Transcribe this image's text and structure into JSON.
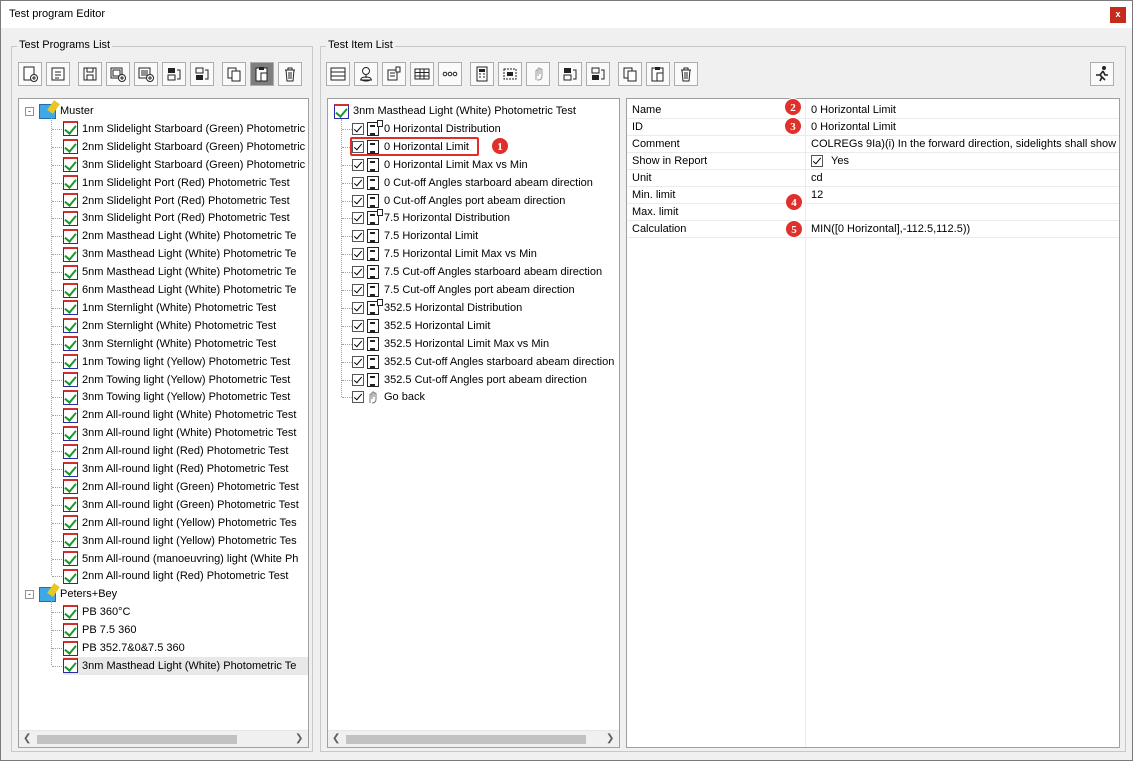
{
  "window": {
    "title": "Test program Editor",
    "close_label": "x"
  },
  "left_group": {
    "label": "Test Programs List",
    "toolbar": [
      "new-program-icon",
      "open-icon",
      "save-icon",
      "add-item-icon",
      "add-copy-icon",
      "move-up-icon",
      "move-down-icon",
      "copy-icon",
      "paste-icon",
      "delete-icon"
    ],
    "folders": [
      {
        "name": "Muster",
        "expander": "-",
        "items": [
          "1nm Slidelight Starboard (Green) Photometric",
          "2nm Slidelight Starboard (Green) Photometric",
          "3nm Slidelight Starboard (Green) Photometric",
          "1nm Slidelight Port (Red) Photometric Test",
          "2nm Slidelight Port (Red) Photometric Test",
          "3nm Slidelight Port (Red) Photometric Test",
          "2nm Masthead Light (White) Photometric Te",
          "3nm Masthead Light (White) Photometric Te",
          "5nm Masthead Light (White) Photometric Te",
          "6nm Masthead Light (White) Photometric Te",
          "1nm Sternlight  (White) Photometric Test",
          "2nm Sternlight  (White) Photometric Test",
          "3nm Sternlight  (White) Photometric Test",
          "1nm Towing light (Yellow) Photometric Test",
          "2nm Towing light (Yellow) Photometric Test",
          "3nm Towing light (Yellow) Photometric Test",
          "2nm All-round light (White) Photometric Test",
          "3nm All-round light (White) Photometric Test",
          "2nm All-round light (Red) Photometric Test",
          "3nm All-round light (Red) Photometric Test",
          "2nm All-round light (Green) Photometric Test",
          "3nm All-round light (Green) Photometric Test",
          "2nm All-round light (Yellow) Photometric Tes",
          "3nm All-round light (Yellow) Photometric Tes",
          "5nm All-round (manoeuvring) light (White Ph",
          "2nm All-round light (Red) Photometric Test"
        ]
      },
      {
        "name": "Peters+Bey",
        "expander": "-",
        "items": [
          "PB 360°C",
          "PB 7.5 360",
          "PB 352.7&0&7.5  360",
          "3nm Masthead Light (White) Photometric Te"
        ]
      }
    ]
  },
  "middle_group": {
    "label": "Test Item List",
    "toolbar": [
      "header-icon",
      "location-icon",
      "distribution-icon",
      "table-icon",
      "dots-icon",
      "calculator-icon",
      "select-icon",
      "hand-icon",
      "move-up-icon",
      "move-down-icon",
      "copy-icon",
      "paste-icon",
      "delete-icon"
    ],
    "run_icon": "run-icon",
    "root": "3nm Masthead Light (White) Photometric Test",
    "items": [
      {
        "label": "0 Horizontal Distribution",
        "icon": "distribution"
      },
      {
        "label": "0 Horizontal Limit",
        "icon": "calc"
      },
      {
        "label": "0 Horizontal Limit Max vs Min",
        "icon": "calc"
      },
      {
        "label": "0 Cut-off Angles starboard abeam direction",
        "icon": "calc"
      },
      {
        "label": "0 Cut-off Angles port abeam direction",
        "icon": "calc"
      },
      {
        "label": "7.5 Horizontal Distribution",
        "icon": "distribution"
      },
      {
        "label": "7.5 Horizontal Limit",
        "icon": "calc"
      },
      {
        "label": "7.5 Horizontal Limit Max vs Min",
        "icon": "calc"
      },
      {
        "label": "7.5 Cut-off Angles starboard abeam direction",
        "icon": "calc"
      },
      {
        "label": "7.5 Cut-off Angles port abeam direction",
        "icon": "calc"
      },
      {
        "label": "352.5 Horizontal Distribution",
        "icon": "distribution"
      },
      {
        "label": "352.5 Horizontal Limit",
        "icon": "calc"
      },
      {
        "label": "352.5 Horizontal Limit Max vs Min",
        "icon": "calc"
      },
      {
        "label": "352.5 Cut-off Angles starboard abeam direction",
        "icon": "calc"
      },
      {
        "label": "352.5 Cut-off Angles port abeam direction",
        "icon": "calc"
      },
      {
        "label": "Go back",
        "icon": "hand"
      }
    ]
  },
  "properties": {
    "rows": [
      {
        "name": "Name",
        "value": "0 Horizontal Limit"
      },
      {
        "name": "ID",
        "value": "0 Horizontal Limit"
      },
      {
        "name": "Comment",
        "value": "COLREGs 9Ia)(i) In the forward direction, sidelights shall show ..."
      },
      {
        "name": "Show in Report",
        "value": "Yes"
      },
      {
        "name": "Unit",
        "value": "cd"
      },
      {
        "name": "Min. limit",
        "value": "12"
      },
      {
        "name": "Max. limit",
        "value": ""
      },
      {
        "name": "Calculation",
        "value": "MIN([0 Horizontal],-112.5,112.5))"
      }
    ]
  },
  "badges": [
    "1",
    "2",
    "3",
    "4",
    "5"
  ],
  "colors": {
    "badge": "#e0302b",
    "highlight": "#e32b2b",
    "check": "#1a9a2a"
  }
}
